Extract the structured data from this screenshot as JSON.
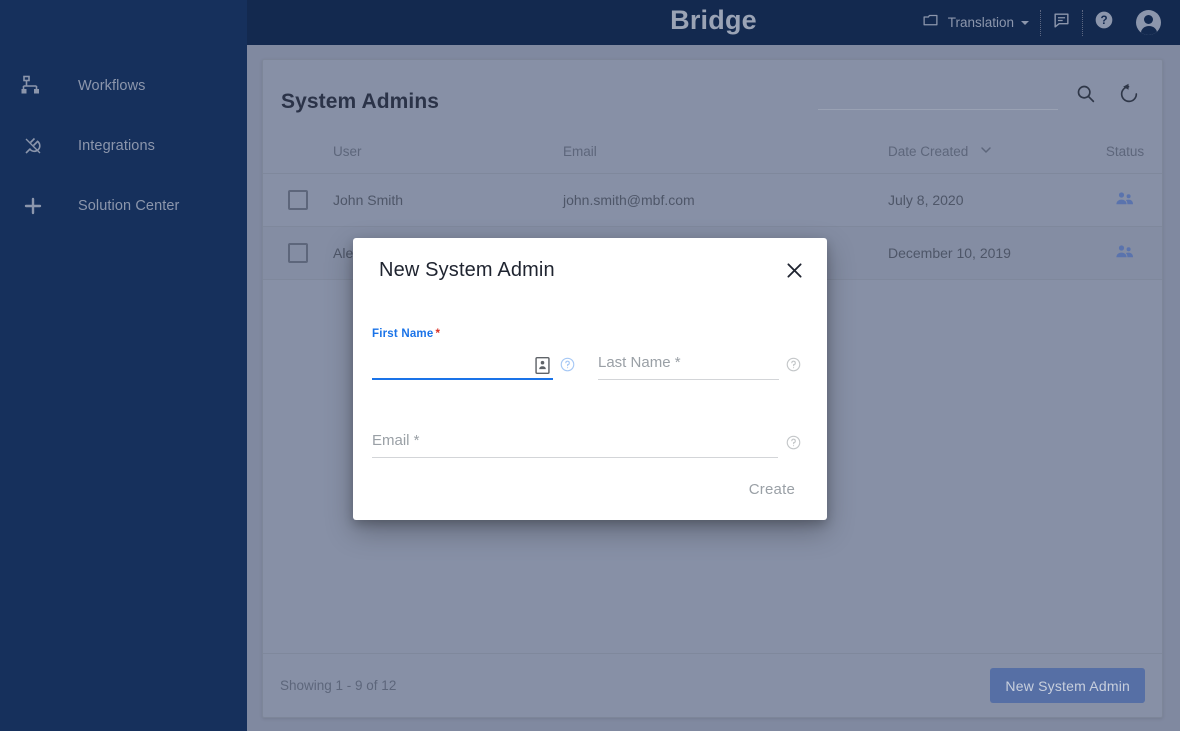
{
  "app": {
    "brand": "Bridge",
    "colors": {
      "sidebar_bg": "#16305c",
      "topbar_bg": "#13294f",
      "overlay_bg": "#8089a0",
      "card_bg": "#8790a6",
      "primary_button": "#566fa5",
      "accent_blue": "#1a73e8",
      "required_red": "#d93025",
      "people_icon": "#5a73ad"
    }
  },
  "sidebar": {
    "items": [
      {
        "label": "Workflows",
        "icon": "workflow-icon"
      },
      {
        "label": "Integrations",
        "icon": "plug-icon"
      },
      {
        "label": "Solution Center",
        "icon": "plus-icon"
      }
    ]
  },
  "topbar": {
    "translation_label": "Translation",
    "icons": [
      {
        "name": "window-icon"
      },
      {
        "name": "chevron-down-icon"
      },
      {
        "name": "feedback-icon"
      },
      {
        "name": "help-icon"
      },
      {
        "name": "account-avatar-icon"
      }
    ]
  },
  "main": {
    "title": "System Admins",
    "search": {
      "value": "",
      "placeholder": ""
    },
    "actions": [
      {
        "name": "search-icon"
      },
      {
        "name": "refresh-icon"
      }
    ],
    "table": {
      "columns": [
        "",
        "User",
        "Email",
        "Date Created",
        "Status"
      ],
      "sort_column": "Date Created",
      "rows": [
        {
          "checked": false,
          "user": "John Smith",
          "email": "john.smith@mbf.com",
          "date_created": "July 8, 2020",
          "status_icon": "people-icon"
        },
        {
          "checked": false,
          "user": "Ale",
          "email": "",
          "date_created": "December 10, 2019",
          "status_icon": "people-icon"
        }
      ]
    },
    "footer": {
      "showing": "Showing 1 - 9 of 12",
      "new_button": "New System Admin"
    }
  },
  "modal": {
    "title": "New System Admin",
    "close_icon": "close-icon",
    "fields": {
      "first_name": {
        "label": "First Name",
        "required_mark": "*",
        "value": "",
        "placeholder": "",
        "focused": true,
        "inline_icon": "contact-card-icon",
        "help_icon": "help-circle-icon"
      },
      "last_name": {
        "label": "",
        "required_mark": "*",
        "value": "",
        "placeholder": "Last Name *",
        "focused": false,
        "help_icon": "help-circle-icon"
      },
      "email": {
        "label": "",
        "required_mark": "*",
        "value": "",
        "placeholder": "Email *",
        "focused": false,
        "help_icon": "help-circle-icon"
      }
    },
    "create_label": "Create"
  }
}
